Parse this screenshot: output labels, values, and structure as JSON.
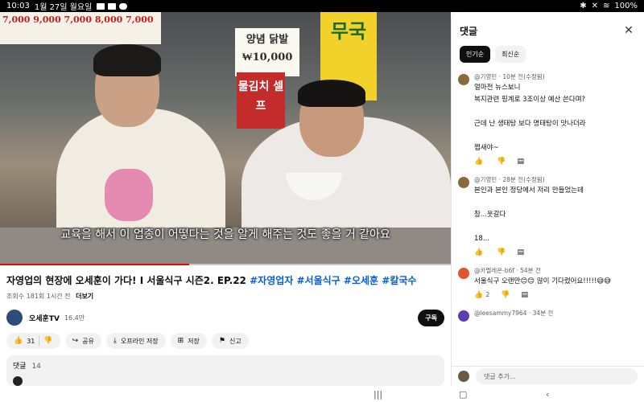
{
  "status_bar": {
    "time": "10:03",
    "date": "1월 27일 월요일",
    "battery": "100%"
  },
  "video": {
    "subtitle": "교육을 해서 이 업종이 어떻다는 것을 알게 해주는 것도 좋을 거 같아요",
    "progress_fraction": 0.42,
    "signs": {
      "menu": "7,000 9,000 7,000 8,000 7,000",
      "dakbal": "양념 닭발 ₩10,000",
      "mulkimchi": "물김치 셀프",
      "mugug": "무국"
    }
  },
  "info": {
    "title_main": "자영업의 현장에 오세훈이 가다! I 서울식구 시즌2. EP.22",
    "hashtags": [
      "#자영업자",
      "#서울식구",
      "#오세훈",
      "#칼국수"
    ],
    "views": "조회수 181회",
    "time_ago": "1시간 전",
    "more": "더보기",
    "channel_name": "오세훈TV",
    "subscribers": "16.4만",
    "subscribe_label": "구독",
    "actions": {
      "like_count": "31",
      "share": "공유",
      "offline_save": "오프라인 저장",
      "save": "저장",
      "report": "신고"
    },
    "comments_label": "댓글",
    "comments_count": "14"
  },
  "panel": {
    "title": "댓글",
    "sort_options": [
      "인기순",
      "최신순"
    ],
    "comments": [
      {
        "author": "@기영민 · 10분 전(수정됨)",
        "avatar_color": "#8a6a3a",
        "lines": [
          "얼마전 뉴스보니",
          "복지관련 핑계로 3조이상 예산 쓴다며?",
          "",
          "근데 난 생태탕 보다 명태탕이 맛나더라",
          "",
          "쩝새야~"
        ],
        "likes": ""
      },
      {
        "author": "@기영민 · 28분 전(수정됨)",
        "avatar_color": "#8a6a3a",
        "lines": [
          "본인과 본인 정당에서 저리 만들었는데",
          "",
          "참...웃갈다",
          "",
          "18..."
        ],
        "likes": ""
      },
      {
        "author": "@카멜레온-b6f · 54분 전",
        "avatar_color": "#e0542f",
        "lines": [
          "서울식구 오랜만😊😊 많이 기다렸어요!!!!!😅😅"
        ],
        "likes": "2"
      },
      {
        "author": "@leesammy7964 · 34분 전",
        "avatar_color": "#5b3fb0",
        "lines": [],
        "likes": ""
      }
    ],
    "add_comment_placeholder": "댓글 추가..."
  }
}
